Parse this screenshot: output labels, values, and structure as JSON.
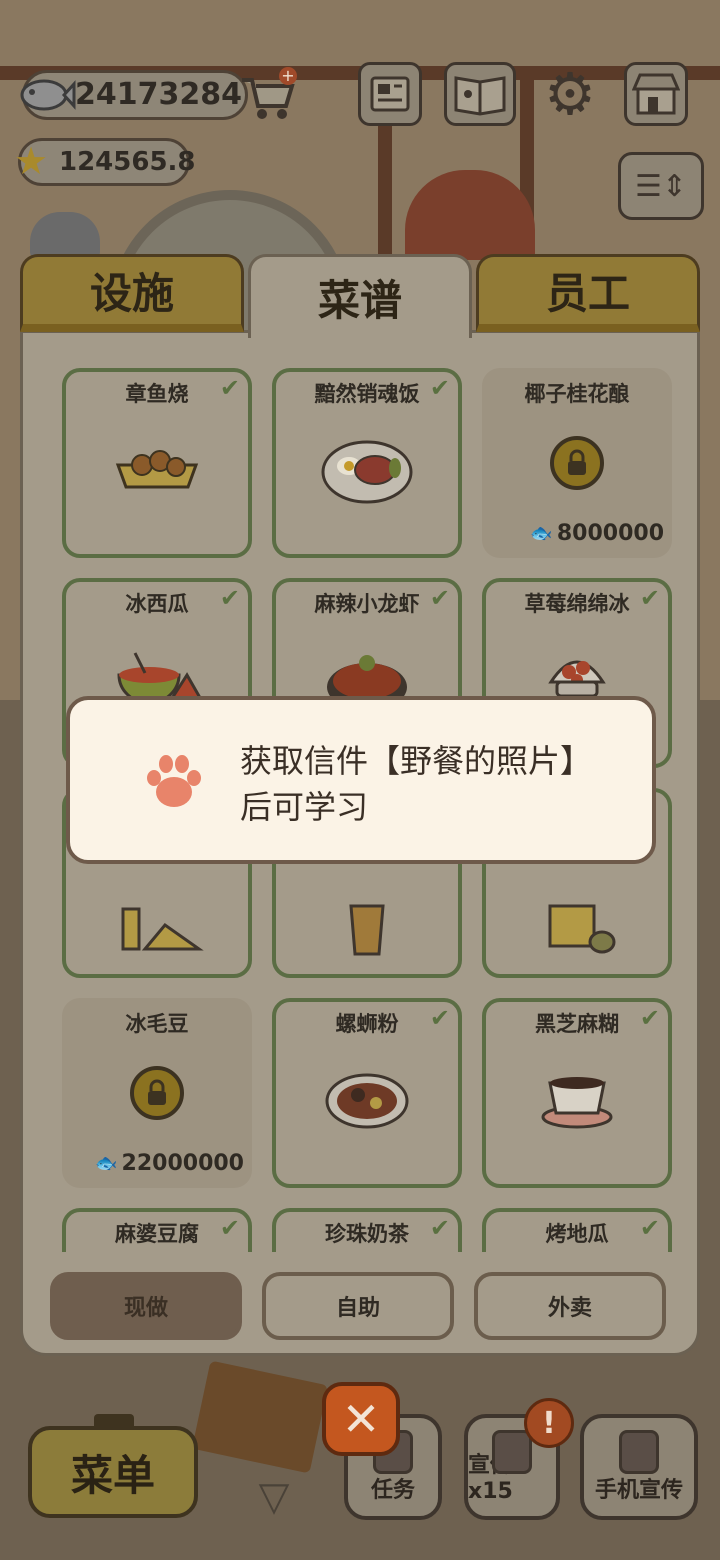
{
  "hud": {
    "fish_coins": "24173284",
    "stars": "124565.8"
  },
  "tabs": [
    {
      "label": "设施",
      "active": false
    },
    {
      "label": "菜谱",
      "active": true
    },
    {
      "label": "员工",
      "active": false
    }
  ],
  "recipes": [
    {
      "name": "章鱼烧",
      "unlocked": true,
      "icon": "takoyaki-icon"
    },
    {
      "name": "黯然销魂饭",
      "unlocked": true,
      "icon": "char-siu-rice-icon"
    },
    {
      "name": "椰子桂花酿",
      "unlocked": false,
      "price": "8000000"
    },
    {
      "name": "冰西瓜",
      "unlocked": true,
      "icon": "watermelon-icon"
    },
    {
      "name": "麻辣小龙虾",
      "unlocked": true,
      "icon": "crayfish-icon"
    },
    {
      "name": "草莓绵绵冰",
      "unlocked": true,
      "icon": "strawberry-ice-icon"
    },
    {
      "name": "",
      "unlocked": true,
      "icon": "cake-icon"
    },
    {
      "name": "",
      "unlocked": true,
      "icon": "drink-icon"
    },
    {
      "name": "",
      "unlocked": true,
      "icon": "noodle-icon"
    },
    {
      "name": "冰毛豆",
      "unlocked": false,
      "price": "22000000"
    },
    {
      "name": "螺蛳粉",
      "unlocked": true,
      "icon": "luosifen-icon"
    },
    {
      "name": "黑芝麻糊",
      "unlocked": true,
      "icon": "sesame-paste-icon"
    },
    {
      "name": "麻婆豆腐",
      "unlocked": true,
      "icon": "mapo-tofu-icon"
    },
    {
      "name": "珍珠奶茶",
      "unlocked": true,
      "icon": "milk-tea-icon"
    },
    {
      "name": "烤地瓜",
      "unlocked": true,
      "icon": "sweet-potato-icon"
    }
  ],
  "bottom_tabs": [
    {
      "label": "现做",
      "selected": true
    },
    {
      "label": "自助",
      "selected": false
    },
    {
      "label": "外卖",
      "selected": false
    }
  ],
  "popup": {
    "line1": "获取信件【野餐的照片】",
    "line2": "后可学习"
  },
  "bottom_bar": {
    "menu_label": "菜单",
    "task_label": "任务",
    "promo_label": "宣传x15",
    "phone_promo_label": "手机宣传",
    "alert_mark": "!"
  },
  "colors": {
    "popup_bg": "#fbf3e6",
    "paw": "#e8846a",
    "close_button": "#c4571f",
    "tab_gold": "#917a36"
  }
}
